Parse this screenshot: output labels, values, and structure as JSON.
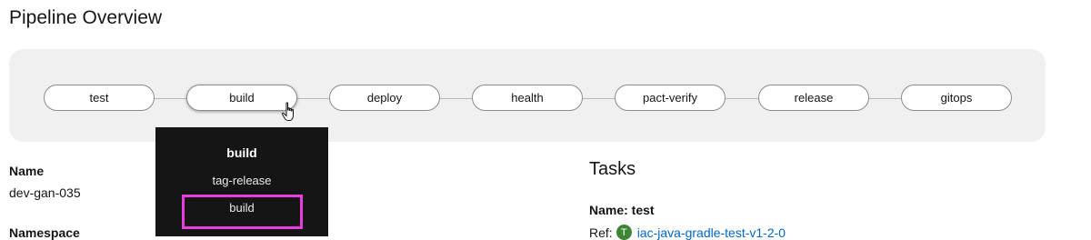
{
  "page": {
    "title": "Pipeline Overview"
  },
  "pipeline": {
    "stages": [
      {
        "label": "test"
      },
      {
        "label": "build"
      },
      {
        "label": "deploy"
      },
      {
        "label": "health"
      },
      {
        "label": "pact-verify"
      },
      {
        "label": "release"
      },
      {
        "label": "gitops"
      }
    ]
  },
  "dropdown": {
    "heading": "build",
    "items": [
      {
        "label": "tag-release"
      },
      {
        "label": "build"
      }
    ]
  },
  "details": {
    "name_label": "Name",
    "name_value": "dev-gan-035",
    "namespace_label": "Namespace"
  },
  "tasks": {
    "title": "Tasks",
    "task_name": "Name: test",
    "ref_label": "Ref:",
    "ref_badge": "T",
    "ref_link": "iac-java-gradle-test-v1-2-0"
  },
  "colors": {
    "link": "#0066cc",
    "badge": "#3e8635",
    "highlight": "#e83ee0",
    "dropdown_bg": "#151515"
  }
}
